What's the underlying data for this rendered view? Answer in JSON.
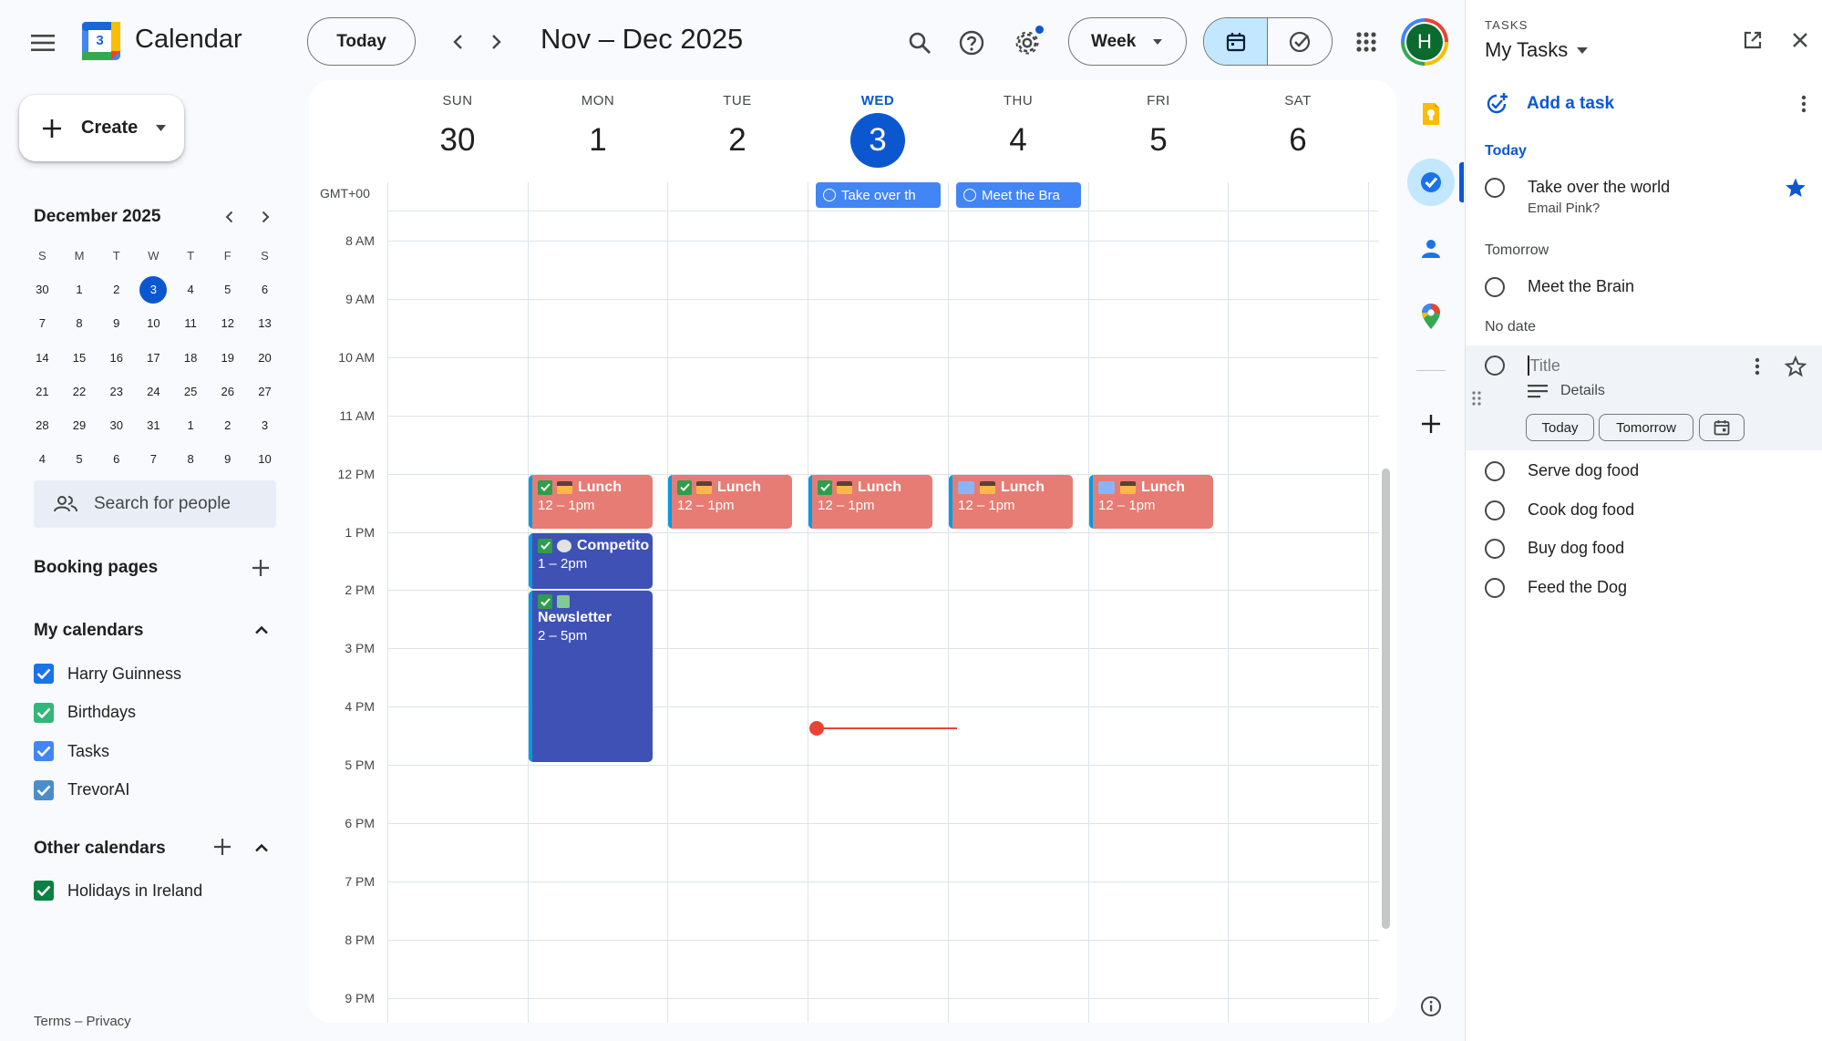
{
  "header": {
    "app_name": "Calendar",
    "logo_text": "3",
    "today_button": "Today",
    "date_range": "Nov – Dec 2025",
    "view_select": "Week",
    "avatar_letter": "H"
  },
  "create_button": "Create",
  "mini_calendar": {
    "title": "December 2025",
    "weekdays": [
      "S",
      "M",
      "T",
      "W",
      "T",
      "F",
      "S"
    ],
    "weeks": [
      [
        "30",
        "1",
        "2",
        "3",
        "4",
        "5",
        "6"
      ],
      [
        "7",
        "8",
        "9",
        "10",
        "11",
        "12",
        "13"
      ],
      [
        "14",
        "15",
        "16",
        "17",
        "18",
        "19",
        "20"
      ],
      [
        "21",
        "22",
        "23",
        "24",
        "25",
        "26",
        "27"
      ],
      [
        "28",
        "29",
        "30",
        "31",
        "1",
        "2",
        "3"
      ],
      [
        "4",
        "5",
        "6",
        "7",
        "8",
        "9",
        "10"
      ]
    ],
    "selected": "3"
  },
  "search_people": "Search for people",
  "booking_pages": "Booking pages",
  "my_calendars": {
    "title": "My calendars",
    "items": [
      {
        "label": "Harry Guinness",
        "color": "#1a73e8"
      },
      {
        "label": "Birthdays",
        "color": "#33b679"
      },
      {
        "label": "Tasks",
        "color": "#4285f4"
      },
      {
        "label": "TrevorAI",
        "color": "#4a8ec9"
      }
    ]
  },
  "other_calendars": {
    "title": "Other calendars",
    "items": [
      {
        "label": "Holidays in Ireland",
        "color": "#0b8043"
      }
    ]
  },
  "footer": "Terms – Privacy",
  "week": {
    "timezone": "GMT+00",
    "days": [
      {
        "dow": "SUN",
        "num": "30"
      },
      {
        "dow": "MON",
        "num": "1"
      },
      {
        "dow": "TUE",
        "num": "2"
      },
      {
        "dow": "WED",
        "num": "3"
      },
      {
        "dow": "THU",
        "num": "4"
      },
      {
        "dow": "FRI",
        "num": "5"
      },
      {
        "dow": "SAT",
        "num": "6"
      }
    ],
    "hours": [
      "8 AM",
      "9 AM",
      "10 AM",
      "11 AM",
      "12 PM",
      "1 PM",
      "2 PM",
      "3 PM",
      "4 PM",
      "5 PM",
      "6 PM",
      "7 PM",
      "8 PM",
      "9 PM"
    ],
    "allday": [
      {
        "title": "Take over th"
      },
      {
        "title": "Meet the Bra"
      }
    ],
    "events": {
      "lunch_title": "Lunch",
      "lunch_time": "12 – 1pm",
      "competition_title": "Competito",
      "competition_time": "1 – 2pm",
      "newsletter_title": "Newsletter",
      "newsletter_time": "2 – 5pm"
    }
  },
  "tasks": {
    "label": "TASKS",
    "list_name": "My Tasks",
    "add_task": "Add a task",
    "groups": {
      "today": "Today",
      "tomorrow": "Tomorrow",
      "no_date": "No date"
    },
    "today_items": [
      {
        "title": "Take over the world",
        "details": "Email Pink?",
        "starred": true
      }
    ],
    "tomorrow_items": [
      {
        "title": "Meet the Brain"
      }
    ],
    "new_task": {
      "placeholder": "Title",
      "details": "Details",
      "chip_today": "Today",
      "chip_tomorrow": "Tomorrow"
    },
    "no_date_items": [
      {
        "title": "Serve dog food"
      },
      {
        "title": "Cook dog food"
      },
      {
        "title": "Buy dog food"
      },
      {
        "title": "Feed the Dog"
      }
    ]
  }
}
